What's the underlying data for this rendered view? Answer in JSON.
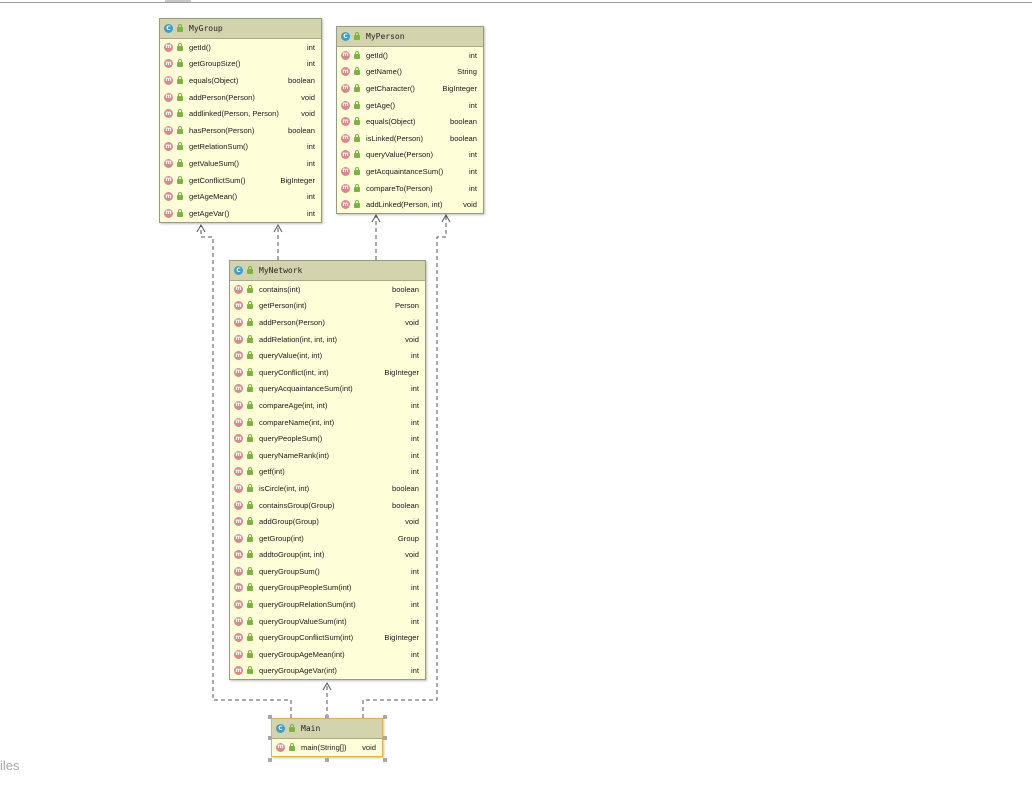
{
  "diagram": {
    "classes": {
      "mygroup": {
        "name": "MyGroup",
        "methods": [
          {
            "name": "getId()",
            "type": "int"
          },
          {
            "name": "getGroupSize()",
            "type": "int"
          },
          {
            "name": "equals(Object)",
            "type": "boolean"
          },
          {
            "name": "addPerson(Person)",
            "type": "void"
          },
          {
            "name": "addlinked(Person, Person)",
            "type": "void"
          },
          {
            "name": "hasPerson(Person)",
            "type": "boolean"
          },
          {
            "name": "getRelationSum()",
            "type": "int"
          },
          {
            "name": "getValueSum()",
            "type": "int"
          },
          {
            "name": "getConflictSum()",
            "type": "BigInteger"
          },
          {
            "name": "getAgeMean()",
            "type": "int"
          },
          {
            "name": "getAgeVar()",
            "type": "int"
          }
        ]
      },
      "myperson": {
        "name": "MyPerson",
        "methods": [
          {
            "name": "getId()",
            "type": "int"
          },
          {
            "name": "getName()",
            "type": "String"
          },
          {
            "name": "getCharacter()",
            "type": "BigInteger"
          },
          {
            "name": "getAge()",
            "type": "int"
          },
          {
            "name": "equals(Object)",
            "type": "boolean"
          },
          {
            "name": "isLinked(Person)",
            "type": "boolean"
          },
          {
            "name": "queryValue(Person)",
            "type": "int"
          },
          {
            "name": "getAcquaintanceSum()",
            "type": "int"
          },
          {
            "name": "compareTo(Person)",
            "type": "int"
          },
          {
            "name": "addLinked(Person, int)",
            "type": "void"
          }
        ]
      },
      "mynetwork": {
        "name": "MyNetwork",
        "methods": [
          {
            "name": "contains(int)",
            "type": "boolean"
          },
          {
            "name": "getPerson(int)",
            "type": "Person"
          },
          {
            "name": "addPerson(Person)",
            "type": "void"
          },
          {
            "name": "addRelation(int, int, int)",
            "type": "void"
          },
          {
            "name": "queryValue(int, int)",
            "type": "int"
          },
          {
            "name": "queryConflict(int, int)",
            "type": "BigInteger"
          },
          {
            "name": "queryAcquaintanceSum(int)",
            "type": "int"
          },
          {
            "name": "compareAge(int, int)",
            "type": "int"
          },
          {
            "name": "compareName(int, int)",
            "type": "int"
          },
          {
            "name": "queryPeopleSum()",
            "type": "int"
          },
          {
            "name": "queryNameRank(int)",
            "type": "int"
          },
          {
            "name": "getf(int)",
            "type": "int"
          },
          {
            "name": "isCircle(int, int)",
            "type": "boolean"
          },
          {
            "name": "containsGroup(Group)",
            "type": "boolean"
          },
          {
            "name": "addGroup(Group)",
            "type": "void"
          },
          {
            "name": "getGroup(int)",
            "type": "Group"
          },
          {
            "name": "addtoGroup(int, int)",
            "type": "void"
          },
          {
            "name": "queryGroupSum()",
            "type": "int"
          },
          {
            "name": "queryGroupPeopleSum(int)",
            "type": "int"
          },
          {
            "name": "queryGroupRelationSum(int)",
            "type": "int"
          },
          {
            "name": "queryGroupValueSum(int)",
            "type": "int"
          },
          {
            "name": "queryGroupConflictSum(int)",
            "type": "BigInteger"
          },
          {
            "name": "queryGroupAgeMean(int)",
            "type": "int"
          },
          {
            "name": "queryGroupAgeVar(int)",
            "type": "int"
          }
        ]
      },
      "main": {
        "name": "Main",
        "methods": [
          {
            "name": "main(String[])",
            "type": "void"
          }
        ]
      }
    },
    "dependencies": [
      {
        "from": "MyNetwork",
        "to": "MyGroup"
      },
      {
        "from": "MyNetwork",
        "to": "MyPerson"
      },
      {
        "from": "Main",
        "to": "MyNetwork"
      },
      {
        "from": "Main",
        "to": "MyGroup"
      },
      {
        "from": "Main",
        "to": "MyPerson"
      }
    ],
    "icons": {
      "class": "class-icon",
      "method": "method-icon",
      "visibility": "public-visibility-icon"
    },
    "colors": {
      "class_fill": "#fefed9",
      "class_header": "#d3d3ad",
      "class_icon": "#3e9ec9",
      "method_icon": "#d9898b",
      "visibility_icon": "#7cb342",
      "selection_border": "#d8b64a"
    }
  },
  "sidebar_fragment": "iles"
}
